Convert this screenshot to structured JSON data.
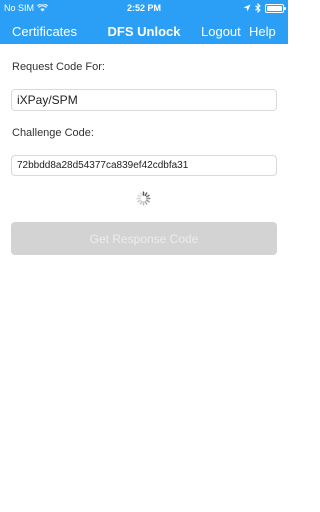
{
  "status_bar": {
    "carrier": "No SIM",
    "time": "2:52 PM",
    "icons": [
      "wifi-icon",
      "location-arrow-icon",
      "bluetooth-icon",
      "battery-icon"
    ],
    "battery_level": 1.0
  },
  "nav": {
    "left_label": "Certificates",
    "title": "DFS Unlock",
    "logout_label": "Logout",
    "help_label": "Help"
  },
  "form": {
    "request_label": "Request Code For:",
    "request_value": "iXPay/SPM",
    "challenge_label": "Challenge Code:",
    "challenge_value": "72bbdd8a28d54377ca839ef42cdbfa31",
    "loading_icon": "spinner-icon",
    "submit_label": "Get Response Code",
    "submit_enabled": false
  },
  "colors": {
    "header": "#2a9ff5",
    "button_disabled": "#d3d3d3",
    "button_text_disabled": "#ececec"
  }
}
